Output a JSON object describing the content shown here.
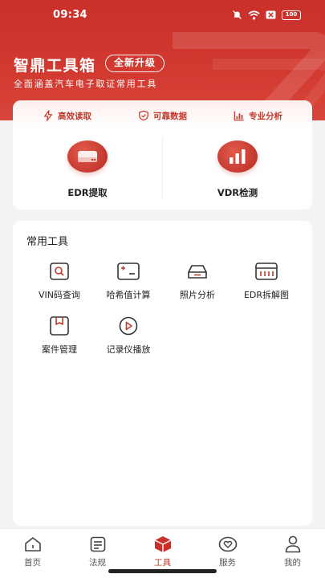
{
  "status_bar": {
    "time": "09:34",
    "battery": "100"
  },
  "header": {
    "title": "智鼎工具箱",
    "badge": "全新升级",
    "subtitle": "全面涵盖汽车电子取证常用工具"
  },
  "features": [
    {
      "label": "高效读取",
      "icon": "lightning-icon"
    },
    {
      "label": "可靠数据",
      "icon": "shield-check-icon"
    },
    {
      "label": "专业分析",
      "icon": "chart-icon"
    }
  ],
  "main_tools": [
    {
      "label": "EDR提取",
      "icon": "drive-icon"
    },
    {
      "label": "VDR检测",
      "icon": "bar-chart-icon"
    }
  ],
  "common_tools": {
    "title": "常用工具",
    "items": [
      {
        "label": "VIN码查询",
        "icon": "vin-search-icon"
      },
      {
        "label": "哈希值计算",
        "icon": "calculator-icon"
      },
      {
        "label": "照片分析",
        "icon": "car-icon"
      },
      {
        "label": "EDR拆解图",
        "icon": "dashboard-icon"
      },
      {
        "label": "案件管理",
        "icon": "folder-box-icon"
      },
      {
        "label": "记录仪播放",
        "icon": "play-icon"
      }
    ]
  },
  "tabbar": [
    {
      "label": "首页",
      "icon": "home-icon",
      "active": false
    },
    {
      "label": "法规",
      "icon": "document-icon",
      "active": false
    },
    {
      "label": "工具",
      "icon": "toolbox-icon",
      "active": true
    },
    {
      "label": "服务",
      "icon": "service-heart-icon",
      "active": false
    },
    {
      "label": "我的",
      "icon": "user-icon",
      "active": false
    }
  ],
  "colors": {
    "brand": "#c9302a",
    "accent": "#c0392b",
    "background": "#f3f3f4"
  }
}
